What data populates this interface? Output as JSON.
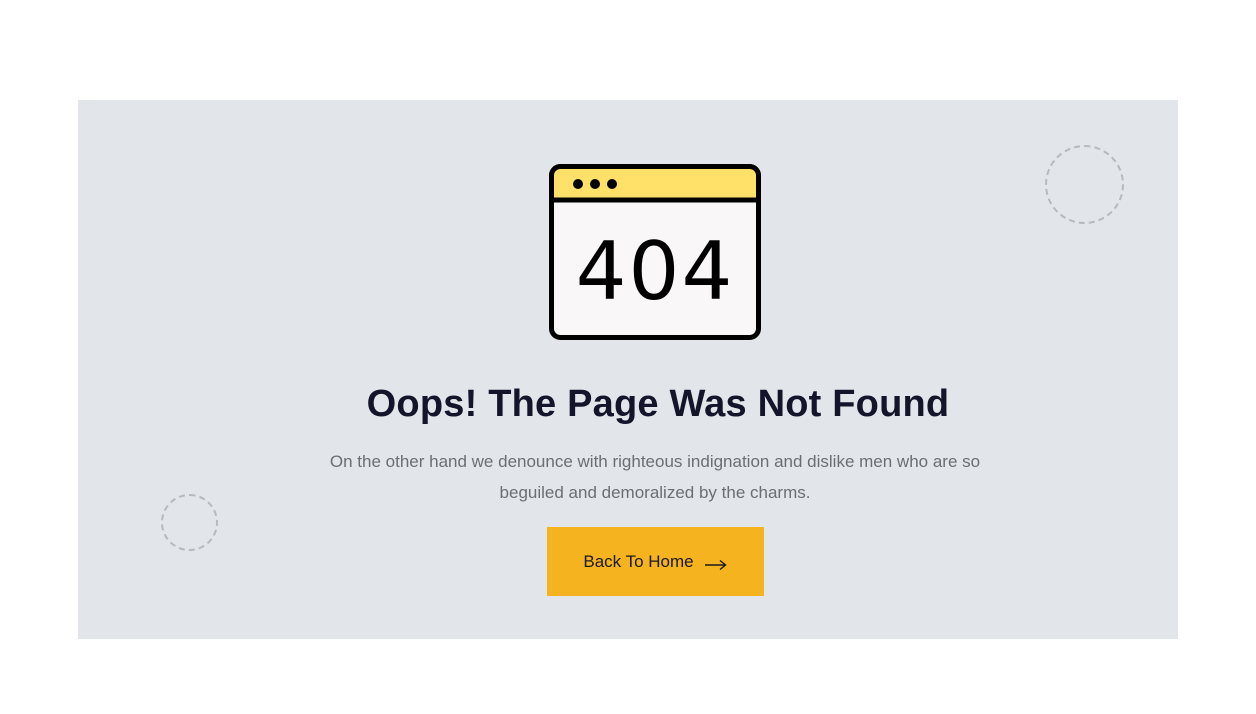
{
  "illustration": {
    "code": "404",
    "icon": "browser-window-404-icon",
    "colors": {
      "titlebar": "#ffe16a",
      "window": "#f9f7f8",
      "stroke": "#000000"
    }
  },
  "headline": "Oops! The Page Was Not Found",
  "description": "On the other hand we denounce with righteous indignation and dislike men who are so beguiled and demoralized by the charms.",
  "button": {
    "label": "Back To Home",
    "icon": "arrow-right-icon",
    "color": "#f4b31f"
  },
  "colors": {
    "panel_background": "#e2e5e9",
    "headline": "#14142b",
    "body_text": "#6b6e73"
  }
}
